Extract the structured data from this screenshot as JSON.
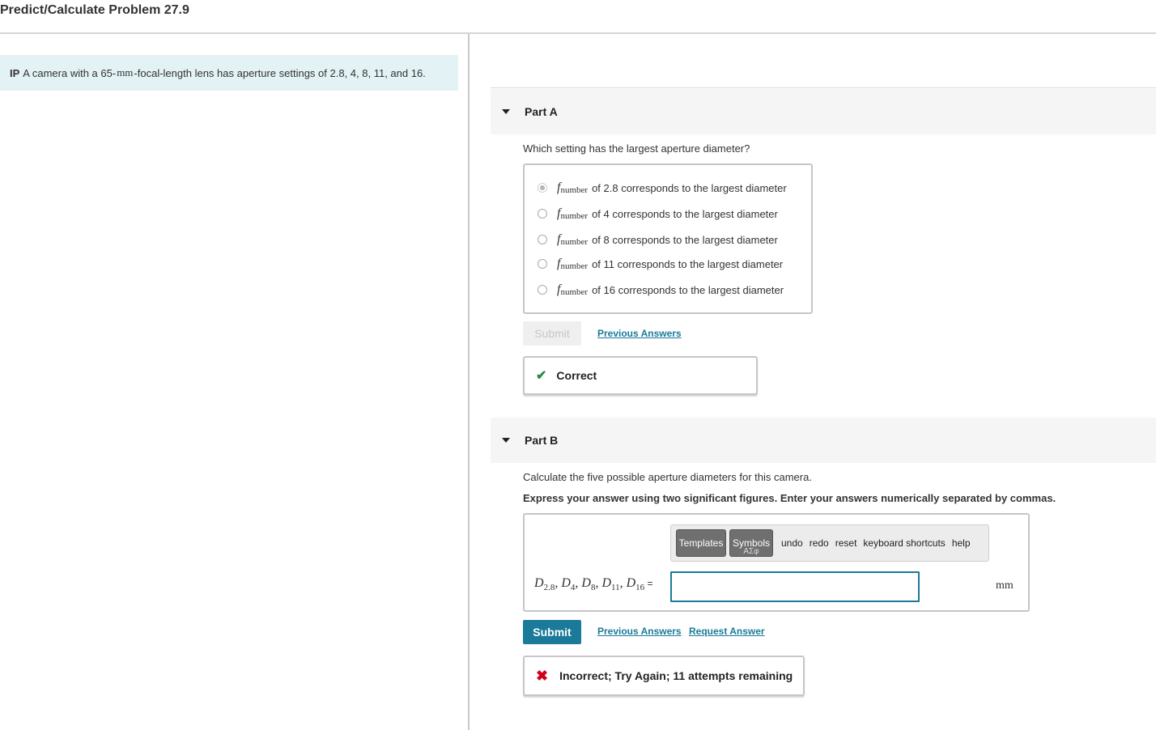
{
  "page": {
    "title": "Predict/Calculate Problem 27.9"
  },
  "intro": {
    "label": "IP",
    "text_before": "A camera with a 65-",
    "unit": "mm",
    "text_after": "-focal-length lens has aperture settings of 2.8, 4, 8, 11, and 16."
  },
  "part_a": {
    "label": "Part A",
    "question": "Which setting has the largest aperture diameter?",
    "choice_symbol": "f",
    "choice_subscript": "number",
    "choices": [
      {
        "text": "of 2.8 corresponds to the largest diameter",
        "selected": true
      },
      {
        "text": "of 4 corresponds to the largest diameter",
        "selected": false
      },
      {
        "text": "of 8 corresponds to the largest diameter",
        "selected": false
      },
      {
        "text": "of 11 corresponds to the largest diameter",
        "selected": false
      },
      {
        "text": "of 16 corresponds to the largest diameter",
        "selected": false
      }
    ],
    "submit_label": "Submit",
    "previous_answers_label": "Previous Answers",
    "feedback": "Correct"
  },
  "part_b": {
    "label": "Part B",
    "question": "Calculate the five possible aperture diameters for this camera.",
    "instructions": "Express your answer using two significant figures. Enter your answers numerically separated by commas.",
    "toolbar": {
      "templates": "Templates",
      "symbols": "Symbols",
      "symbols_glyph": "ΑΣφ",
      "undo": "undo",
      "redo": "redo",
      "reset": "reset",
      "keyboard_shortcuts": "keyboard shortcuts",
      "help": "help"
    },
    "equation": {
      "d": "D",
      "s1": "2.8",
      "s2": "4",
      "s3": "8",
      "s4": "11",
      "s5": "16",
      "sep": ", ",
      "equals": " ="
    },
    "answer_value": "",
    "unit": "mm",
    "submit_label": "Submit",
    "previous_answers_label": "Previous Answers",
    "request_answer_label": "Request Answer",
    "feedback": "Incorrect; Try Again; 11 attempts remaining"
  },
  "colors": {
    "accent": "#1b7a99",
    "correct": "#2b8a3e",
    "incorrect": "#d0021b",
    "intro_bg": "#e3f2f4"
  }
}
